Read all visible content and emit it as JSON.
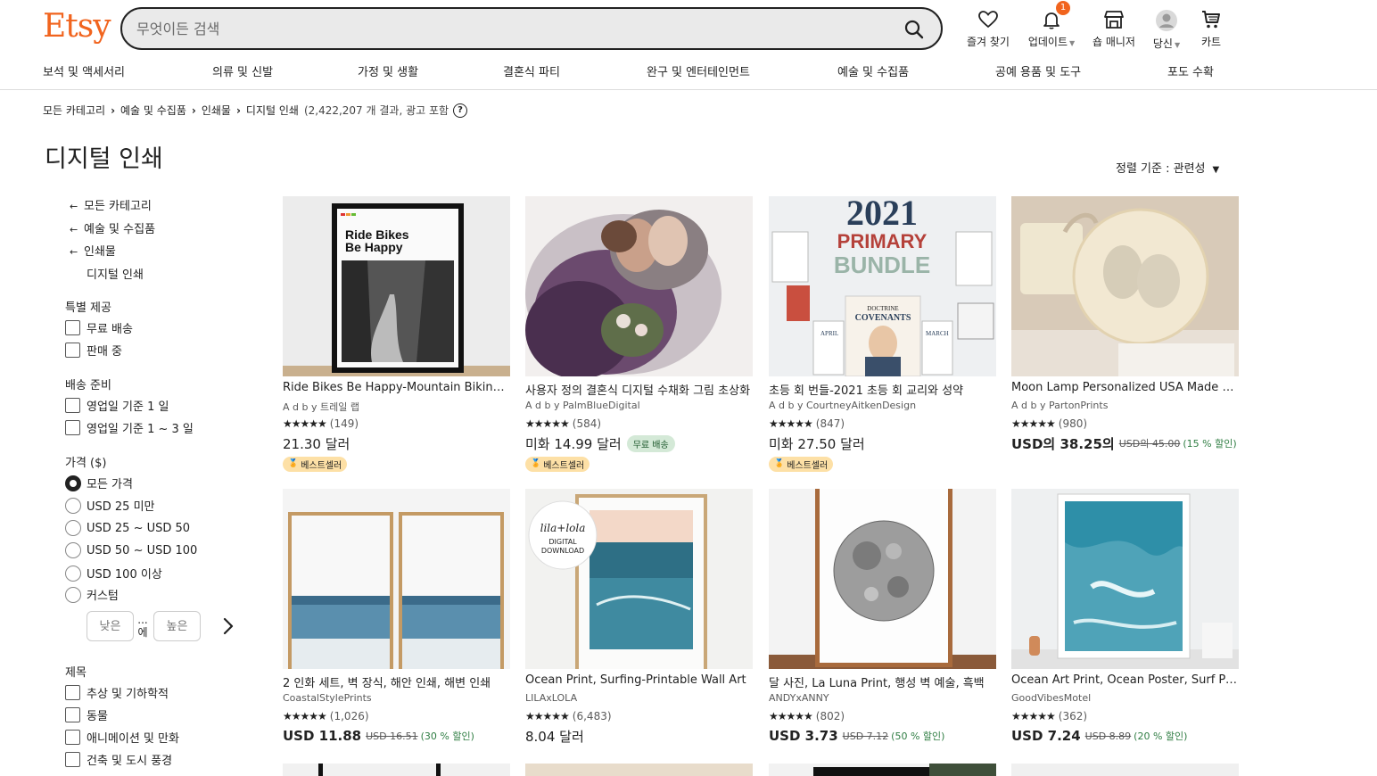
{
  "header": {
    "logo": "Etsy",
    "search_placeholder": "무엇이든 검색",
    "icons": [
      {
        "label": "즐겨 찾기",
        "icon": "heart-icon"
      },
      {
        "label": "업데이트",
        "icon": "bell-icon",
        "badge": "1"
      },
      {
        "label": "숍 매니저",
        "icon": "shop-icon"
      },
      {
        "label": "당신",
        "icon": "avatar-icon"
      },
      {
        "label": "카트",
        "icon": "cart-icon"
      }
    ],
    "nav": [
      "보석 및 액세서리",
      "의류 및 신발",
      "가정 및 생활",
      "결혼식 파티",
      "완구 및 엔터테인먼트",
      "예술 및 수집품",
      "공예 용품 및 도구",
      "포도 수확"
    ]
  },
  "breadcrumb": {
    "items": [
      "모든 카테고리",
      "예술 및 수집품",
      "인쇄물",
      "디지털 인쇄"
    ],
    "count": "(2,422,207 개 결과, 광고 포함",
    "help": "?"
  },
  "page_title": "디지털 인쇄",
  "sort_label": "정렬 기준 : 관련성",
  "sidebar": {
    "categories": [
      "모든 카테고리",
      "예술 및 수집품",
      "인쇄물",
      "디지털 인쇄"
    ],
    "special_title": "특별 제공",
    "special": [
      "무료 배송",
      "판매 중"
    ],
    "ship_title": "배송 준비",
    "ship": [
      "영업일 기준 1 일",
      "영업일 기준 1 ~ 3 일"
    ],
    "price_title": "가격 ($)",
    "price": [
      "모든 가격",
      "USD 25 미만",
      "USD 25 ~ USD 50",
      "USD 50 ~ USD 100",
      "USD 100 이상",
      "커스텀"
    ],
    "price_low": "낮은",
    "price_high": "높은",
    "price_sep": "...\n에",
    "subject_title": "제목",
    "subject": [
      "추상 및 기하학적",
      "동물",
      "애니메이션 및 만화",
      "건축 및 도시 풍경"
    ]
  },
  "products": [
    {
      "title": "Ride Bikes Be Happy-Mountain Biking Poster",
      "shop": "A d b y 트레일 랩",
      "stars": "★★★★★",
      "reviews": "(149)",
      "price": "21.30 달러",
      "orig": "",
      "disc": "",
      "free": "",
      "bestseller": "베스트셀러",
      "img_text": [
        "Ride Bikes",
        "Be Happy"
      ]
    },
    {
      "title": "사용자 정의 결혼식 디지털 수채화 그림 초상화",
      "shop": "A d b y PalmBlueDigital",
      "stars": "★★★★★",
      "reviews": "(584)",
      "price": "미화 14.99 달러",
      "orig": "",
      "disc": "",
      "free": "무료 배송",
      "bestseller": "베스트셀러"
    },
    {
      "title": "초등 회 번들-2021 초등 회 교리와 성약",
      "shop": "A d b y CourtneyAitkenDesign",
      "stars": "★★★★★",
      "reviews": "(847)",
      "price": "미화 27.50 달러",
      "orig": "",
      "disc": "",
      "free": "",
      "bestseller": "베스트셀러",
      "img_text": [
        "2021",
        "PRIMARY",
        "BUNDLE",
        "DOCTRINE",
        "COVENANTS",
        "APRIL",
        "MARCH"
      ]
    },
    {
      "title": "Moon Lamp Personalized USA Made Gift",
      "shop": "A d b y PartonPrints",
      "stars": "★★★★★",
      "reviews": "(980)",
      "price": "USD의 38.25의",
      "orig": "USD의 45.00",
      "disc": "(15 % 할인)",
      "free": "",
      "bestseller": ""
    },
    {
      "title": "2 인화 세트, 벽 장식, 해안 인쇄, 해변 인쇄",
      "shop": "CoastalStylePrints",
      "stars": "★★★★★",
      "reviews": "(1,026)",
      "price": "USD 11.88",
      "orig": "USD 16.51",
      "disc": "(30 % 할인)",
      "free": "",
      "bestseller": ""
    },
    {
      "title": "Ocean Print, Surfing-Printable Wall Art",
      "shop": "LILAxLOLA",
      "stars": "★★★★★",
      "reviews": "(6,483)",
      "price": "8.04 달러",
      "orig": "",
      "disc": "",
      "free": "",
      "bestseller": "",
      "img_text": [
        "lila+lola",
        "DIGITAL",
        "DOWNLOAD"
      ]
    },
    {
      "title": "달 사진, La Luna Print, 행성 벽 예술, 흑백",
      "shop": "ANDYxANNY",
      "stars": "★★★★★",
      "reviews": "(802)",
      "price": "USD 3.73",
      "orig": "USD 7.12",
      "disc": "(50 % 할인)",
      "free": "",
      "bestseller": ""
    },
    {
      "title": "Ocean Art Print, Ocean Poster, Surf Print",
      "shop": "GoodVibesMotel",
      "stars": "★★★★★",
      "reviews": "(362)",
      "price": "USD 7.24",
      "orig": "USD 8.89",
      "disc": "(20 % 할인)",
      "free": "",
      "bestseller": ""
    }
  ],
  "colors": {
    "brand": "#F1641E",
    "discount": "#2f7d43",
    "bestseller": "#fde0a6",
    "free_shipping": "#d4e9d7"
  }
}
